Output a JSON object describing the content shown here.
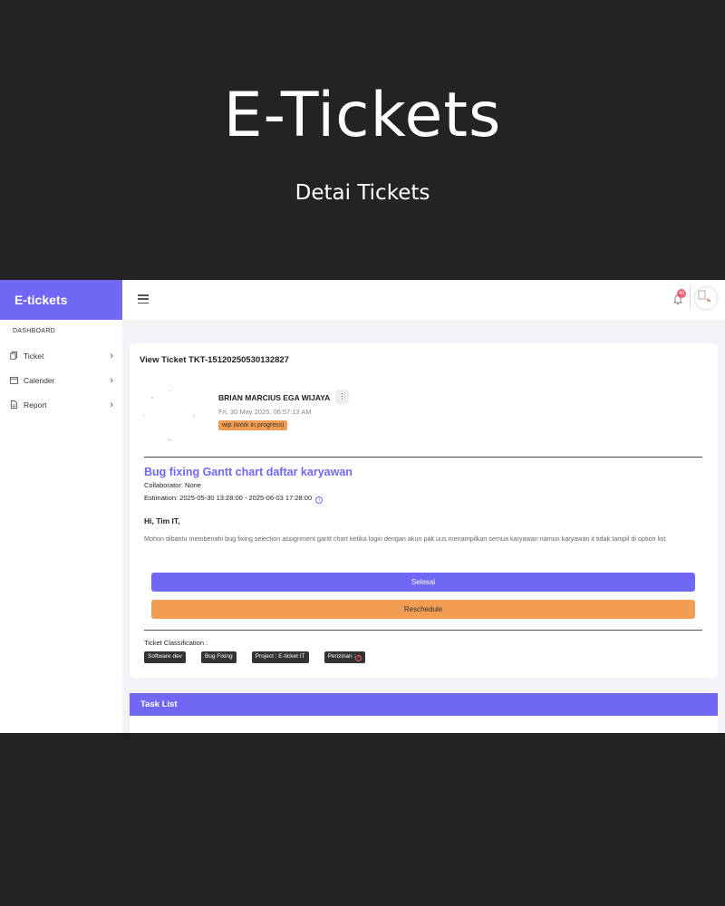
{
  "hero": {
    "title": "E-Tickets",
    "subtitle": "Detai Tickets"
  },
  "sidebar": {
    "brand": "E-tickets",
    "section": "DASHBOARD",
    "items": [
      {
        "label": "Ticket",
        "icon": "copy-icon"
      },
      {
        "label": "Calender",
        "icon": "calendar-icon"
      },
      {
        "label": "Report",
        "icon": "document-icon"
      }
    ]
  },
  "topbar": {
    "notification_count": "40"
  },
  "ticket": {
    "view_title": "View Ticket TKT-15120250530132827",
    "user_name": "BRIAN MARCIUS EGA WIJAYA",
    "date": "Fri, 30 May 2025, 06:57:13 AM",
    "status": "wip (work in progress)",
    "status_color": "#f29d52",
    "title": "Bug fixing Gantt chart daftar karyawan",
    "collaborator": "Collaborator: None",
    "estimation": "Estimation: 2025-05-30 13:28:00 - 2025-06-03 17:28:00",
    "greeting": "Hi, Tim IT,",
    "message": "Mohon dibantu membenahi bug fixing selection assignment gantt chart ketika login dengan akun pak uus menampilkan semua karyawan namun karyawan it tidak tampil di option list",
    "btn_done": "Selesai",
    "btn_reschedule": "Reschedule",
    "classification_label": "Ticket Classification :",
    "tags": [
      "Software dev",
      "Bug Fixing",
      "Project : E-ticket IT",
      "Perizinan :"
    ]
  },
  "task_list": {
    "title": "Task List"
  },
  "colors": {
    "accent": "#7068f4",
    "warning": "#f29d52",
    "background": "#232323"
  }
}
